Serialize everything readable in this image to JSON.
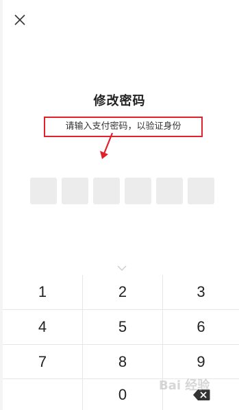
{
  "header": {
    "close_icon": "close-icon"
  },
  "dialog": {
    "title": "修改密码",
    "subtitle": "请输入支付密码，以验证身份",
    "annotation_color": "#e0202a",
    "pin_length": 6,
    "collapse_icon": "chevron-down-icon"
  },
  "keypad": {
    "keys": [
      "1",
      "2",
      "3",
      "4",
      "5",
      "6",
      "7",
      "8",
      "9",
      "0"
    ],
    "delete_icon": "backspace-icon"
  },
  "watermark": {
    "text": "Bai 经验"
  }
}
